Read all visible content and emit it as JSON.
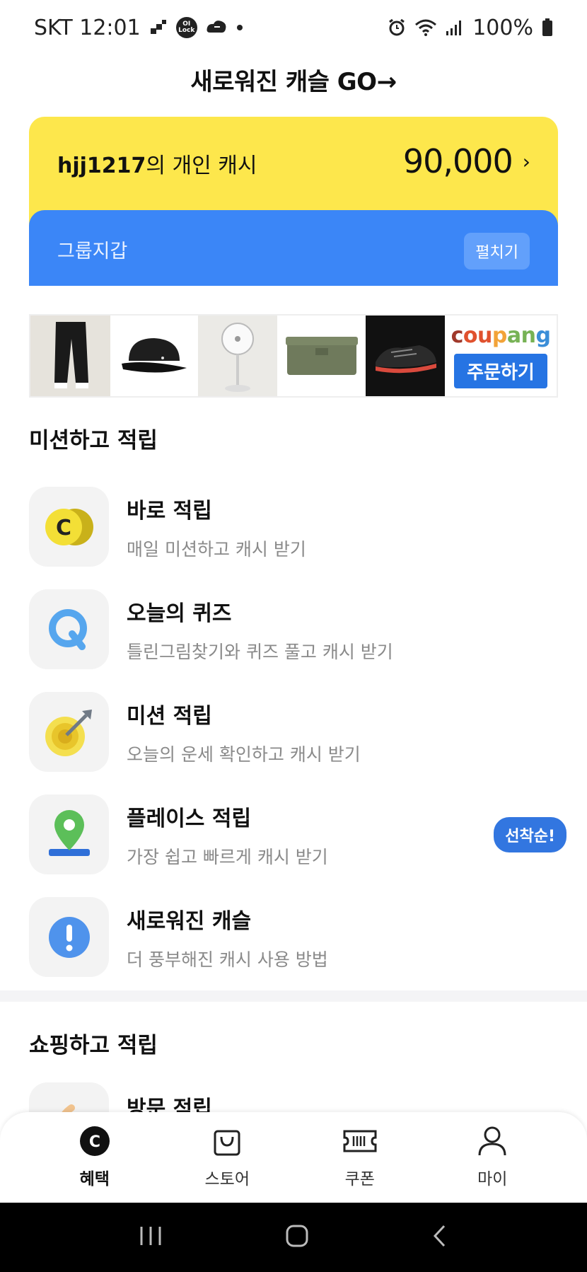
{
  "status_bar": {
    "carrier_time": "SKT 12:01",
    "lock_badge": "OI Lock",
    "battery": "100%",
    "icons": [
      "alarm-icon",
      "wifi-icon",
      "signal-icon",
      "battery-icon"
    ]
  },
  "header": {
    "banner": "새로워진 캐슬  GO→"
  },
  "cash_card": {
    "owner": "hjj1217",
    "suffix": "의 개인 캐시",
    "amount": "90,000",
    "chevron": "›"
  },
  "group_wallet": {
    "title": "그룹지갑",
    "expand_label": "펼치기"
  },
  "ad": {
    "brand": "coupang",
    "brand_letters": [
      "c",
      "ou",
      "p",
      "an",
      "g"
    ],
    "order_label": "주문하기"
  },
  "missions": {
    "section_title": "미션하고 적립",
    "items": [
      {
        "title": "바로 적립",
        "subtitle": "매일 미션하고 캐시 받기",
        "icon": "coin-icon"
      },
      {
        "title": "오늘의 퀴즈",
        "subtitle": "틀린그림찾기와 퀴즈 풀고 캐시 받기",
        "icon": "quiz-icon"
      },
      {
        "title": "미션 적립",
        "subtitle": "오늘의 운세 확인하고 캐시 받기",
        "icon": "target-icon"
      },
      {
        "title": "플레이스 적립",
        "subtitle": "가장 쉽고 빠르게 캐시 받기",
        "icon": "location-pin-icon",
        "badge": "선착순!"
      },
      {
        "title": "새로워진 캐슬",
        "subtitle": "더 풍부해진 캐시 사용 방법",
        "icon": "info-icon"
      }
    ]
  },
  "shopping": {
    "section_title": "쇼핑하고 적립",
    "first_item_title": "방문 적립"
  },
  "bottom_nav": {
    "items": [
      {
        "label": "혜택",
        "icon": "cash-c-icon",
        "active": true
      },
      {
        "label": "스토어",
        "icon": "shopping-bag-icon",
        "active": false
      },
      {
        "label": "쿠폰",
        "icon": "ticket-icon",
        "active": false
      },
      {
        "label": "마이",
        "icon": "person-icon",
        "active": false
      }
    ]
  },
  "colors": {
    "cash_card": "#fde74c",
    "group_wallet": "#3b86f7",
    "badge": "#3276e0"
  }
}
